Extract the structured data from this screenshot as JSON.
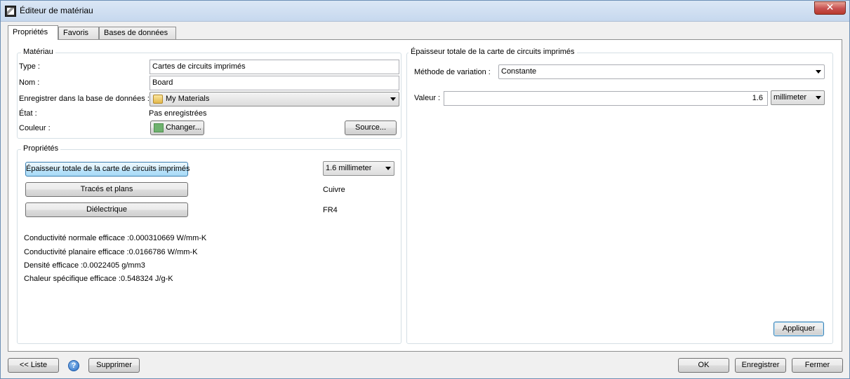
{
  "window": {
    "title": "Éditeur de matériau",
    "close_label": "✕"
  },
  "tabs": [
    "Propriétés",
    "Favoris",
    "Bases de données"
  ],
  "materiau": {
    "group_title": "Matériau",
    "type_label": "Type :",
    "type_value": "Cartes de circuits imprimés",
    "nom_label": "Nom :",
    "nom_value": "Board",
    "db_label": "Enregistrer dans la base de données :",
    "db_value": "My Materials",
    "etat_label": "État :",
    "etat_value": "Pas enregistrées",
    "couleur_label": "Couleur :",
    "couleur_button": "Changer...",
    "couleur_swatch": "#6fb26f",
    "source_button": "Source..."
  },
  "proprietes": {
    "group_title": "Propriétés",
    "epaisseur_button": "Épaisseur totale de la carte de circuits imprimés",
    "epaisseur_value": "1.6 millimeter",
    "traces_button": "Tracés et plans",
    "traces_value": "Cuivre",
    "dielectrique_button": "Diélectrique",
    "dielectrique_value": "FR4",
    "stats": [
      "Conductivité normale efficace :0.000310669 W/mm-K",
      "Conductivité planaire efficace :0.0166786 W/mm-K",
      "Densité efficace :0.0022405 g/mm3",
      "Chaleur spécifique efficace :0.548324 J/g-K"
    ]
  },
  "detail": {
    "group_title": "Épaisseur totale de la carte de circuits imprimés",
    "methode_label": "Méthode de variation :",
    "methode_value": "Constante",
    "valeur_label": "Valeur :",
    "valeur_value": "1.6",
    "unit_value": "millimeter",
    "apply_button": "Appliquer"
  },
  "footer": {
    "liste_button": "<< Liste",
    "help_glyph": "?",
    "supprimer_button": "Supprimer",
    "ok_button": "OK",
    "enregistrer_button": "Enregistrer",
    "fermer_button": "Fermer"
  }
}
